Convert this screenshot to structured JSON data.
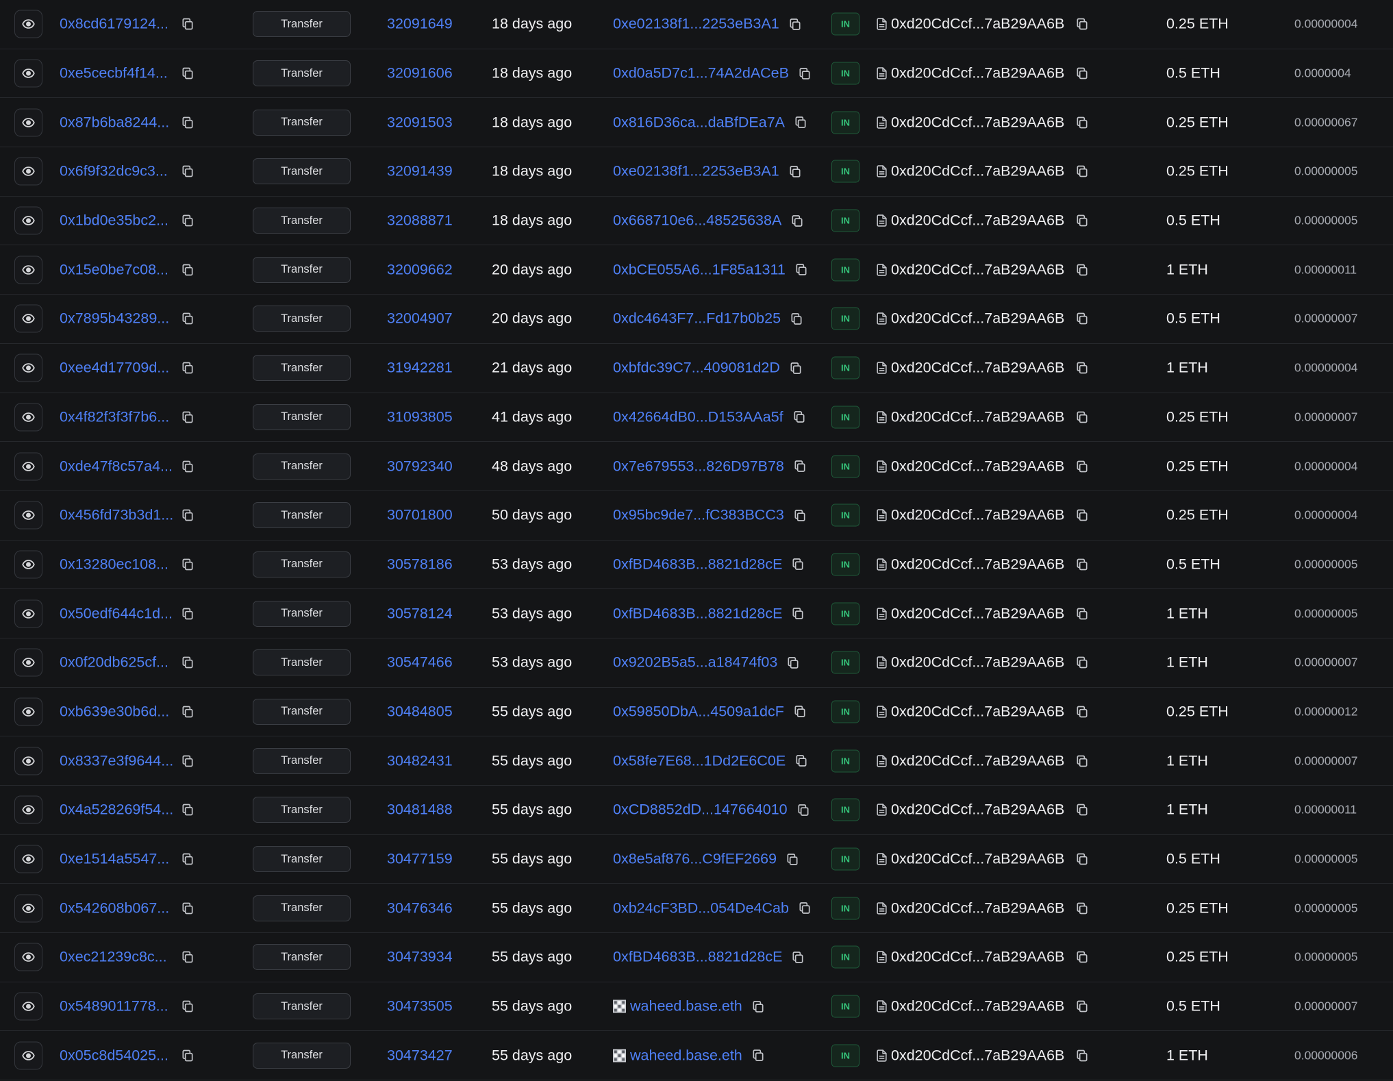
{
  "table": {
    "rows": [
      {
        "txn_hash": "0x8cd6179124...",
        "method": "Transfer",
        "block": "32091649",
        "age": "18 days ago",
        "from": "0xe02138f1...2253eB3A1",
        "from_icon": "",
        "direction": "IN",
        "to": "0xd20CdCcf...7aB29AA6B",
        "amount": "0.25 ETH",
        "fee": "0.00000004"
      },
      {
        "txn_hash": "0xe5cecbf4f14...",
        "method": "Transfer",
        "block": "32091606",
        "age": "18 days ago",
        "from": "0xd0a5D7c1...74A2dACeB",
        "from_icon": "",
        "direction": "IN",
        "to": "0xd20CdCcf...7aB29AA6B",
        "amount": "0.5 ETH",
        "fee": "0.0000004"
      },
      {
        "txn_hash": "0x87b6ba8244...",
        "method": "Transfer",
        "block": "32091503",
        "age": "18 days ago",
        "from": "0x816D36ca...daBfDEa7A",
        "from_icon": "",
        "direction": "IN",
        "to": "0xd20CdCcf...7aB29AA6B",
        "amount": "0.25 ETH",
        "fee": "0.00000067"
      },
      {
        "txn_hash": "0x6f9f32dc9c3...",
        "method": "Transfer",
        "block": "32091439",
        "age": "18 days ago",
        "from": "0xe02138f1...2253eB3A1",
        "from_icon": "",
        "direction": "IN",
        "to": "0xd20CdCcf...7aB29AA6B",
        "amount": "0.25 ETH",
        "fee": "0.00000005"
      },
      {
        "txn_hash": "0x1bd0e35bc2...",
        "method": "Transfer",
        "block": "32088871",
        "age": "18 days ago",
        "from": "0x668710e6...48525638A",
        "from_icon": "",
        "direction": "IN",
        "to": "0xd20CdCcf...7aB29AA6B",
        "amount": "0.5 ETH",
        "fee": "0.00000005"
      },
      {
        "txn_hash": "0x15e0be7c08...",
        "method": "Transfer",
        "block": "32009662",
        "age": "20 days ago",
        "from": "0xbCE055A6...1F85a1311",
        "from_icon": "",
        "direction": "IN",
        "to": "0xd20CdCcf...7aB29AA6B",
        "amount": "1 ETH",
        "fee": "0.00000011"
      },
      {
        "txn_hash": "0x7895b43289...",
        "method": "Transfer",
        "block": "32004907",
        "age": "20 days ago",
        "from": "0xdc4643F7...Fd17b0b25",
        "from_icon": "",
        "direction": "IN",
        "to": "0xd20CdCcf...7aB29AA6B",
        "amount": "0.5 ETH",
        "fee": "0.00000007"
      },
      {
        "txn_hash": "0xee4d17709d...",
        "method": "Transfer",
        "block": "31942281",
        "age": "21 days ago",
        "from": "0xbfdc39C7...409081d2D",
        "from_icon": "",
        "direction": "IN",
        "to": "0xd20CdCcf...7aB29AA6B",
        "amount": "1 ETH",
        "fee": "0.00000004"
      },
      {
        "txn_hash": "0x4f82f3f3f7b6...",
        "method": "Transfer",
        "block": "31093805",
        "age": "41 days ago",
        "from": "0x42664dB0...D153AAa5f",
        "from_icon": "",
        "direction": "IN",
        "to": "0xd20CdCcf...7aB29AA6B",
        "amount": "0.25 ETH",
        "fee": "0.00000007"
      },
      {
        "txn_hash": "0xde47f8c57a4...",
        "method": "Transfer",
        "block": "30792340",
        "age": "48 days ago",
        "from": "0x7e679553...826D97B78",
        "from_icon": "",
        "direction": "IN",
        "to": "0xd20CdCcf...7aB29AA6B",
        "amount": "0.25 ETH",
        "fee": "0.00000004"
      },
      {
        "txn_hash": "0x456fd73b3d1...",
        "method": "Transfer",
        "block": "30701800",
        "age": "50 days ago",
        "from": "0x95bc9de7...fC383BCC3",
        "from_icon": "",
        "direction": "IN",
        "to": "0xd20CdCcf...7aB29AA6B",
        "amount": "0.25 ETH",
        "fee": "0.00000004"
      },
      {
        "txn_hash": "0x13280ec108...",
        "method": "Transfer",
        "block": "30578186",
        "age": "53 days ago",
        "from": "0xfBD4683B...8821d28cE",
        "from_icon": "",
        "direction": "IN",
        "to": "0xd20CdCcf...7aB29AA6B",
        "amount": "0.5 ETH",
        "fee": "0.00000005"
      },
      {
        "txn_hash": "0x50edf644c1d...",
        "method": "Transfer",
        "block": "30578124",
        "age": "53 days ago",
        "from": "0xfBD4683B...8821d28cE",
        "from_icon": "",
        "direction": "IN",
        "to": "0xd20CdCcf...7aB29AA6B",
        "amount": "1 ETH",
        "fee": "0.00000005"
      },
      {
        "txn_hash": "0x0f20db625cf...",
        "method": "Transfer",
        "block": "30547466",
        "age": "53 days ago",
        "from": "0x9202B5a5...a18474f03",
        "from_icon": "",
        "direction": "IN",
        "to": "0xd20CdCcf...7aB29AA6B",
        "amount": "1 ETH",
        "fee": "0.00000007"
      },
      {
        "txn_hash": "0xb639e30b6d...",
        "method": "Transfer",
        "block": "30484805",
        "age": "55 days ago",
        "from": "0x59850DbA...4509a1dcF",
        "from_icon": "",
        "direction": "IN",
        "to": "0xd20CdCcf...7aB29AA6B",
        "amount": "0.25 ETH",
        "fee": "0.00000012"
      },
      {
        "txn_hash": "0x8337e3f9644...",
        "method": "Transfer",
        "block": "30482431",
        "age": "55 days ago",
        "from": "0x58fe7E68...1Dd2E6C0E",
        "from_icon": "",
        "direction": "IN",
        "to": "0xd20CdCcf...7aB29AA6B",
        "amount": "1 ETH",
        "fee": "0.00000007"
      },
      {
        "txn_hash": "0x4a528269f54...",
        "method": "Transfer",
        "block": "30481488",
        "age": "55 days ago",
        "from": "0xCD8852dD...147664010",
        "from_icon": "",
        "direction": "IN",
        "to": "0xd20CdCcf...7aB29AA6B",
        "amount": "1 ETH",
        "fee": "0.00000011"
      },
      {
        "txn_hash": "0xe1514a5547...",
        "method": "Transfer",
        "block": "30477159",
        "age": "55 days ago",
        "from": "0x8e5af876...C9fEF2669",
        "from_icon": "",
        "direction": "IN",
        "to": "0xd20CdCcf...7aB29AA6B",
        "amount": "0.5 ETH",
        "fee": "0.00000005"
      },
      {
        "txn_hash": "0x542608b067...",
        "method": "Transfer",
        "block": "30476346",
        "age": "55 days ago",
        "from": "0xb24cF3BD...054De4Cab",
        "from_icon": "",
        "direction": "IN",
        "to": "0xd20CdCcf...7aB29AA6B",
        "amount": "0.25 ETH",
        "fee": "0.00000005"
      },
      {
        "txn_hash": "0xec21239c8c...",
        "method": "Transfer",
        "block": "30473934",
        "age": "55 days ago",
        "from": "0xfBD4683B...8821d28cE",
        "from_icon": "",
        "direction": "IN",
        "to": "0xd20CdCcf...7aB29AA6B",
        "amount": "0.25 ETH",
        "fee": "0.00000005"
      },
      {
        "txn_hash": "0x5489011778...",
        "method": "Transfer",
        "block": "30473505",
        "age": "55 days ago",
        "from": "waheed.base.eth",
        "from_icon": "ens-avatar-icon",
        "direction": "IN",
        "to": "0xd20CdCcf...7aB29AA6B",
        "amount": "0.5 ETH",
        "fee": "0.00000007"
      },
      {
        "txn_hash": "0x05c8d54025...",
        "method": "Transfer",
        "block": "30473427",
        "age": "55 days ago",
        "from": "waheed.base.eth",
        "from_icon": "ens-avatar-icon",
        "direction": "IN",
        "to": "0xd20CdCcf...7aB29AA6B",
        "amount": "1 ETH",
        "fee": "0.00000006"
      }
    ]
  },
  "icons": {
    "view": "eye-icon",
    "copy": "copy-icon",
    "contract": "document-icon",
    "ens": "ens-avatar-icon"
  },
  "colors": {
    "background": "#141517",
    "link": "#4f80f6",
    "text": "#f0f0f2",
    "muted": "#a6a9b0",
    "row_border": "#26282c",
    "in_badge_text": "#35c47a",
    "in_badge_bg": "#15261d",
    "in_badge_border": "#1f5b3a"
  }
}
